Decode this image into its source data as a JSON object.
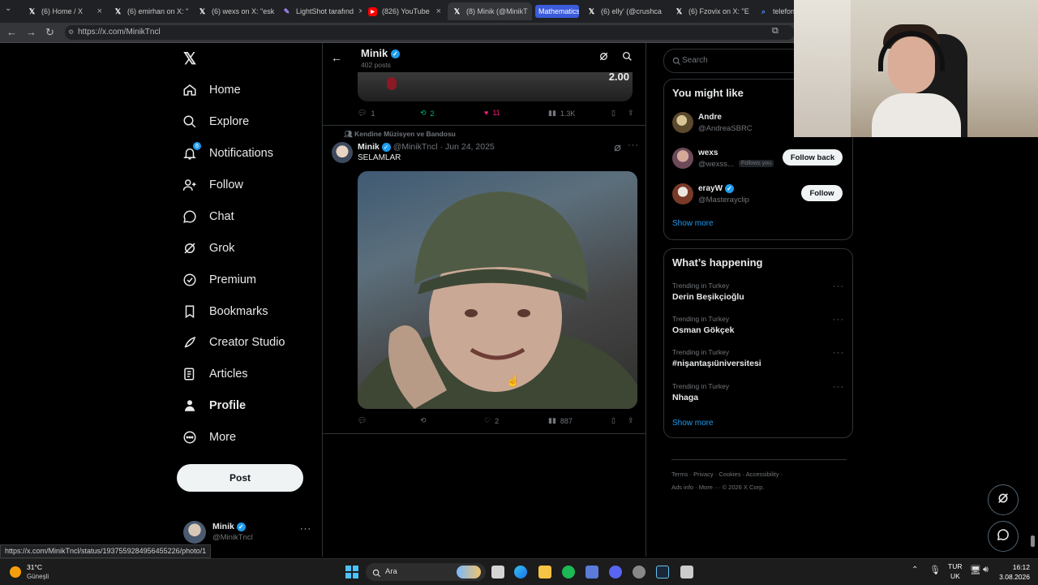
{
  "browser": {
    "tabs": [
      {
        "title": "(6) Home / X",
        "icon": "x-logo"
      },
      {
        "title": "(6) emirhan on X: \"",
        "icon": "x-logo"
      },
      {
        "title": "(6) wexs on X: \"esk",
        "icon": "x-logo"
      },
      {
        "title": "LightShot tarafınd",
        "icon": "lightshot-feather"
      },
      {
        "title": "(826) YouTube",
        "icon": "youtube-logo"
      },
      {
        "title": "(8) Minik (@MinikT",
        "icon": "x-logo"
      },
      {
        "title": "Mathematics",
        "icon": "none"
      },
      {
        "title": "(6) elly' (@crushca",
        "icon": "x-logo"
      },
      {
        "title": "(6) Fzovix on X: \"E",
        "icon": "x-logo"
      },
      {
        "title": "telefon k",
        "icon": "search-logo"
      }
    ],
    "url": "https://x.com/MinikTncl",
    "status_url": "https://x.com/MinikTncl/status/1937559284956455226/photo/1"
  },
  "sidebar": {
    "items": [
      {
        "label": "Home",
        "icon": "home-icon"
      },
      {
        "label": "Explore",
        "icon": "search-icon"
      },
      {
        "label": "Notifications",
        "icon": "bell-icon",
        "badge": "6"
      },
      {
        "label": "Follow",
        "icon": "add-user-icon"
      },
      {
        "label": "Chat",
        "icon": "chat-icon"
      },
      {
        "label": "Grok",
        "icon": "grok-icon"
      },
      {
        "label": "Premium",
        "icon": "verified-icon"
      },
      {
        "label": "Bookmarks",
        "icon": "bookmark-icon"
      },
      {
        "label": "Creator Studio",
        "icon": "rocket-icon"
      },
      {
        "label": "Articles",
        "icon": "article-icon"
      },
      {
        "label": "Profile",
        "icon": "person-icon"
      },
      {
        "label": "More",
        "icon": "more-circle-icon"
      }
    ],
    "post_label": "Post",
    "account": {
      "name": "Minik",
      "handle": "@MinikTncl"
    }
  },
  "header": {
    "name": "Minik",
    "posts": "402 posts"
  },
  "prev_post": {
    "media_text": "2.00",
    "replies": "1",
    "reposts": "2",
    "likes": "11",
    "views": "1.3K"
  },
  "post": {
    "social_context": "Kendine Müzisyen ve Bandosu",
    "name": "Minik",
    "handle": "@MinikTncl",
    "date": "· Jun 24, 2025",
    "text": "SELAMLAR",
    "replies": "",
    "reposts": "",
    "likes": "2",
    "views": "887"
  },
  "right": {
    "search_placeholder": "Search",
    "might_like_title": "You might like",
    "suggestions": [
      {
        "name": "Andre",
        "handle": "@AndreaSBRC",
        "verified": false,
        "action": ""
      },
      {
        "name": "wexs",
        "handle": "@wexss...",
        "tag": "Follows you",
        "verified": false,
        "action": "Follow back"
      },
      {
        "name": "erayW",
        "handle": "@Masterayclip",
        "verified": true,
        "action": "Follow"
      }
    ],
    "show_more": "Show more",
    "happening_title": "What’s happening",
    "trends": [
      {
        "context": "Trending in Turkey",
        "topic": "Derin Beşikçioğlu"
      },
      {
        "context": "Trending in Turkey",
        "topic": "Osman Gökçek"
      },
      {
        "context": "Trending in Turkey",
        "topic": "#nişantaşıüniversitesi"
      },
      {
        "context": "Trending in Turkey",
        "topic": "Nhaga"
      }
    ],
    "show_more_2": "Show more",
    "footer_line1": [
      "Terms",
      "Privacy",
      "Cookies",
      "Accessibility"
    ],
    "footer_more": "More ···",
    "footer_ads": "Ads info",
    "footer_copy": "© 2026 X Corp."
  },
  "taskbar": {
    "weather_temp": "31°C",
    "weather_desc": "Güneşli",
    "search": "Ara",
    "lang1": "TUR",
    "lang2": "UK",
    "time": "16:12",
    "date": "3.08.2026"
  },
  "colors": {
    "accent": "#1d9bf0",
    "like": "#f91880",
    "repost": "#00ba7c"
  }
}
